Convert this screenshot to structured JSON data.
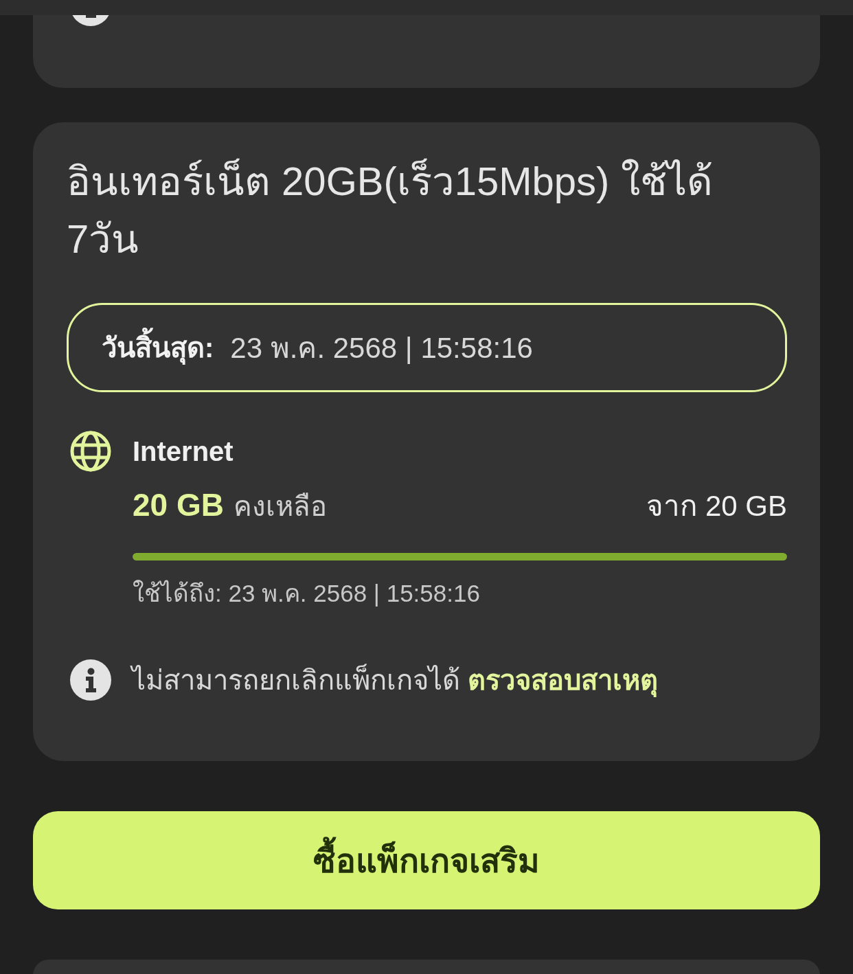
{
  "package": {
    "title": "อินเทอร์เน็ต 20GB(เร็ว15Mbps) ใช้ได้ 7วัน",
    "expiry": {
      "label": "วันสิ้นสุด:",
      "value": "23 พ.ค. 2568 | 15:58:16"
    },
    "quotas": [
      {
        "name": "Internet",
        "remaining": "20 GB",
        "remaining_label": "คงเหลือ",
        "total": "จาก 20 GB",
        "level": 1,
        "valid_until": "ใช้ได้ถึง: 23 พ.ค. 2568 | 15:58:16"
      }
    ],
    "notice": {
      "text": "ไม่สามารถยกเลิกแพ็กเกจได้",
      "link": "ตรวจสอบสาเหตุ"
    }
  },
  "buy_button": "ซื้อแพ็กเกจเสริม"
}
